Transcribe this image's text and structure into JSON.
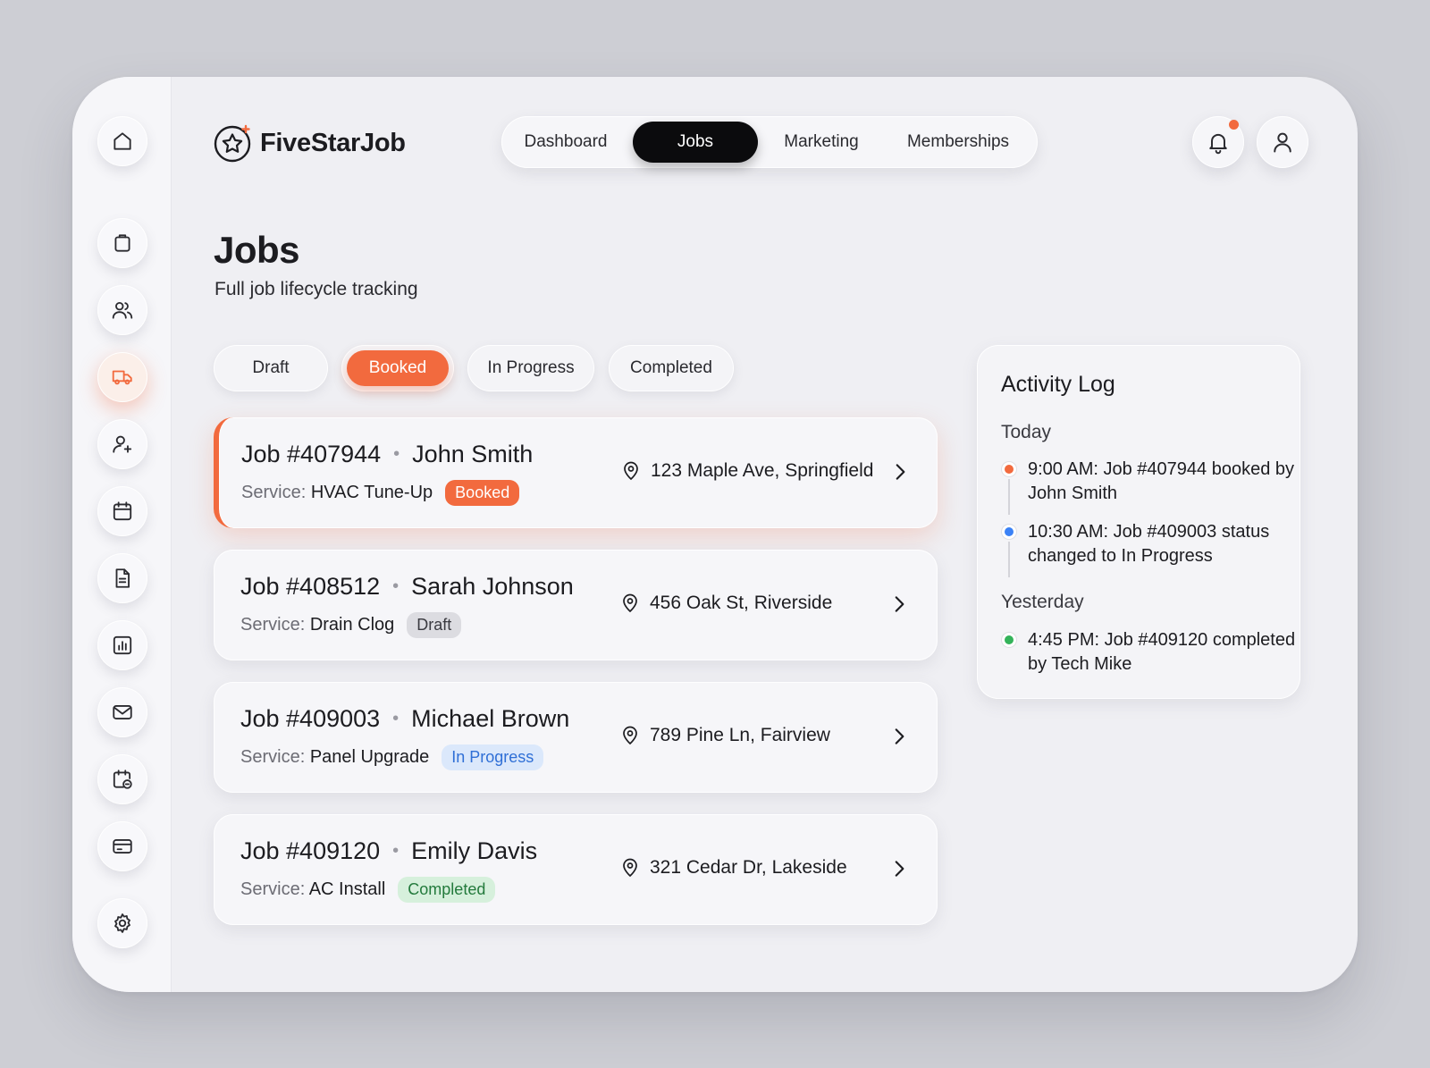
{
  "brand": {
    "name": "FiveStarJob"
  },
  "topnav": {
    "items": [
      {
        "label": "Dashboard",
        "active": false
      },
      {
        "label": "Jobs",
        "active": true
      },
      {
        "label": "Marketing",
        "active": false
      },
      {
        "label": "Memberships",
        "active": false
      }
    ]
  },
  "sidebar": {
    "icons": [
      "home-icon",
      "clipboard-icon",
      "users-icon",
      "truck-icon",
      "user-plus-icon",
      "calendar-icon",
      "document-icon",
      "chart-icon",
      "mail-icon",
      "calendar-clock-icon",
      "credit-card-icon",
      "gear-icon"
    ],
    "active": "truck-icon"
  },
  "header_actions": [
    "bell-icon",
    "user-icon"
  ],
  "page": {
    "title": "Jobs",
    "subtitle": "Full job lifecycle tracking"
  },
  "filters": [
    {
      "label": "Draft",
      "active": false
    },
    {
      "label": "Booked",
      "active": true
    },
    {
      "label": "In Progress",
      "active": false
    },
    {
      "label": "Completed",
      "active": false
    }
  ],
  "jobs": [
    {
      "id": "Job #407944",
      "customer": "John Smith",
      "service_label": "Service:",
      "service": "HVAC Tune-Up",
      "status": "Booked",
      "address": "123 Maple Ave, Springfield"
    },
    {
      "id": "Job #408512",
      "customer": "Sarah Johnson",
      "service_label": "Service:",
      "service": "Drain Clog",
      "status": "Draft",
      "address": "456 Oak St, Riverside"
    },
    {
      "id": "Job #409003",
      "customer": "Michael Brown",
      "service_label": "Service:",
      "service": "Panel Upgrade",
      "status": "In Progress",
      "address": "789 Pine Ln, Fairview"
    },
    {
      "id": "Job #409120",
      "customer": "Emily Davis",
      "service_label": "Service:",
      "service": "AC Install",
      "status": "Completed",
      "address": "321 Cedar Dr, Lakeside"
    }
  ],
  "activity": {
    "title": "Activity Log",
    "groups": [
      {
        "label": "Today",
        "items": [
          {
            "text": "9:00 AM: Job #407944 booked by John Smith",
            "color": "#f26a3e"
          },
          {
            "text": "10:30 AM: Job #409003 status changed to In Progress",
            "color": "#3b82f6"
          }
        ]
      },
      {
        "label": "Yesterday",
        "items": [
          {
            "text": "4:45 PM: Job #409120 completed by Tech Mike",
            "color": "#34b35a"
          }
        ]
      }
    ]
  },
  "colors": {
    "accent": "#f26a3e",
    "dark": "#0b0b0d",
    "info": "#3b82f6",
    "success": "#34b35a"
  }
}
